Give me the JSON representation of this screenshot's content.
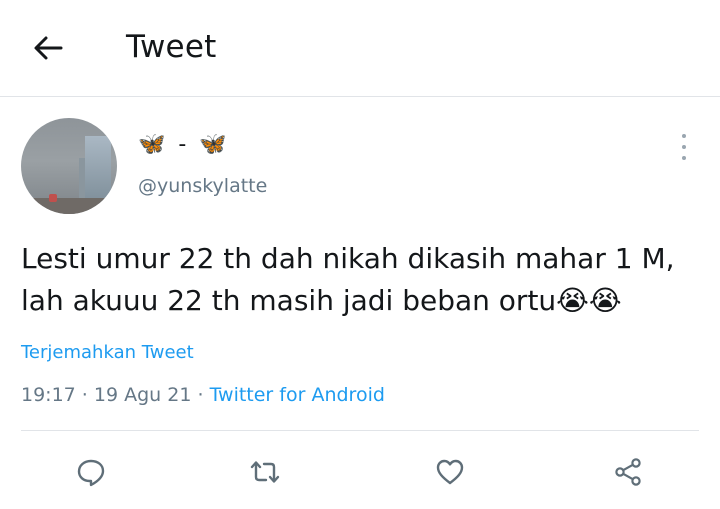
{
  "header": {
    "title": "Tweet",
    "back_icon": "arrow-left-icon"
  },
  "author": {
    "display_name_prefix": "🦋",
    "display_name_sep": " - ",
    "display_name_suffix": "🦋",
    "handle": "@yunskylatte"
  },
  "tweet": {
    "line1": "Lesti umur 22 th dah nikah dikasih mahar 1 M,",
    "line2": "lah akuuu 22 th masih jadi beban ortu😭😭",
    "translate_label": "Terjemahkan Tweet",
    "time": "19:17",
    "sep": " · ",
    "date": "19 Agu 21",
    "source": "Twitter for Android"
  },
  "actions": [
    {
      "icon": "reply-icon"
    },
    {
      "icon": "retweet-icon"
    },
    {
      "icon": "like-icon"
    },
    {
      "icon": "share-icon"
    }
  ],
  "colors": {
    "link": "#1d9bf0",
    "secondary_text": "#657786",
    "icon": "#5f6e78",
    "divider": "#e1e4e8"
  }
}
